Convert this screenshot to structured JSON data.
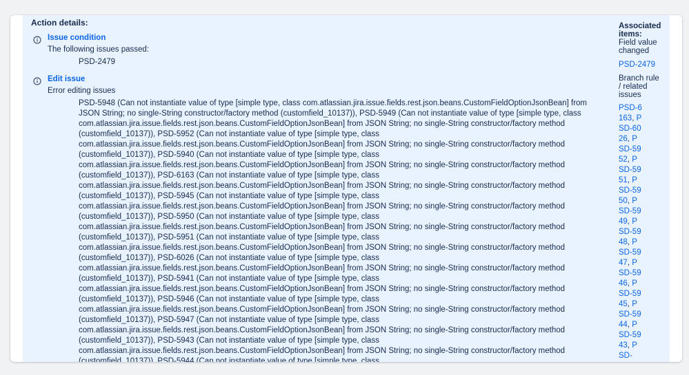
{
  "action_details": {
    "heading": "Action details:",
    "issue_condition": {
      "title": "Issue condition",
      "subtitle": "The following issues passed:",
      "issue": "PSD-2479"
    },
    "edit_issue": {
      "title": "Edit issue",
      "subtitle": "Error editing issues",
      "error_text": "PSD-5948 (Can not instantiate value of type [simple type, class com.atlassian.jira.issue.fields.rest.json.beans.CustomFieldOptionJsonBean] from JSON String; no single-String constructor/factory method (customfield_10137)), PSD-5949 (Can not instantiate value of type [simple type, class com.atlassian.jira.issue.fields.rest.json.beans.CustomFieldOptionJsonBean] from JSON String; no single-String constructor/factory method (customfield_10137)), PSD-5952 (Can not instantiate value of type [simple type, class com.atlassian.jira.issue.fields.rest.json.beans.CustomFieldOptionJsonBean] from JSON String; no single-String constructor/factory method (customfield_10137)), PSD-5940 (Can not instantiate value of type [simple type, class com.atlassian.jira.issue.fields.rest.json.beans.CustomFieldOptionJsonBean] from JSON String; no single-String constructor/factory method (customfield_10137)), PSD-6163 (Can not instantiate value of type [simple type, class com.atlassian.jira.issue.fields.rest.json.beans.CustomFieldOptionJsonBean] from JSON String; no single-String constructor/factory method (customfield_10137)), PSD-5945 (Can not instantiate value of type [simple type, class com.atlassian.jira.issue.fields.rest.json.beans.CustomFieldOptionJsonBean] from JSON String; no single-String constructor/factory method (customfield_10137)), PSD-5950 (Can not instantiate value of type [simple type, class com.atlassian.jira.issue.fields.rest.json.beans.CustomFieldOptionJsonBean] from JSON String; no single-String constructor/factory method (customfield_10137)), PSD-5951 (Can not instantiate value of type [simple type, class com.atlassian.jira.issue.fields.rest.json.beans.CustomFieldOptionJsonBean] from JSON String; no single-String constructor/factory method (customfield_10137)), PSD-6026 (Can not instantiate value of type [simple type, class com.atlassian.jira.issue.fields.rest.json.beans.CustomFieldOptionJsonBean] from JSON String; no single-String constructor/factory method (customfield_10137)), PSD-5941 (Can not instantiate value of type [simple type, class com.atlassian.jira.issue.fields.rest.json.beans.CustomFieldOptionJsonBean] from JSON String; no single-String constructor/factory method (customfield_10137)), PSD-5946 (Can not instantiate value of type [simple type, class com.atlassian.jira.issue.fields.rest.json.beans.CustomFieldOptionJsonBean] from JSON String; no single-String constructor/factory method (customfield_10137)), PSD-5947 (Can not instantiate value of type [simple type, class com.atlassian.jira.issue.fields.rest.json.beans.CustomFieldOptionJsonBean] from JSON String; no single-String constructor/factory method (customfield_10137)), PSD-5943 (Can not instantiate value of type [simple type, class com.atlassian.jira.issue.fields.rest.json.beans.CustomFieldOptionJsonBean] from JSON String; no single-String constructor/factory method (customfield_10137)), PSD-5944 (Can not instantiate value of type [simple type, class"
    }
  },
  "associated_items": {
    "heading": "Associated items:",
    "field_value_label": "Field value changed",
    "field_value_issue": "PSD-2479",
    "branch_label": "Branch rule / related issues",
    "related_issues": [
      "PSD-6163",
      "PSD-6026",
      "PSD-5952",
      "PSD-5951",
      "PSD-5950",
      "PSD-5949",
      "PSD-5948",
      "PSD-5947",
      "PSD-5946",
      "PSD-5945",
      "PSD-5944",
      "PSD-5943",
      "PSD-"
    ]
  },
  "icons": {
    "info": "info-icon"
  },
  "colors": {
    "link": "#0c66e4",
    "panel": "#e9f2ff",
    "text": "#172b4d"
  }
}
